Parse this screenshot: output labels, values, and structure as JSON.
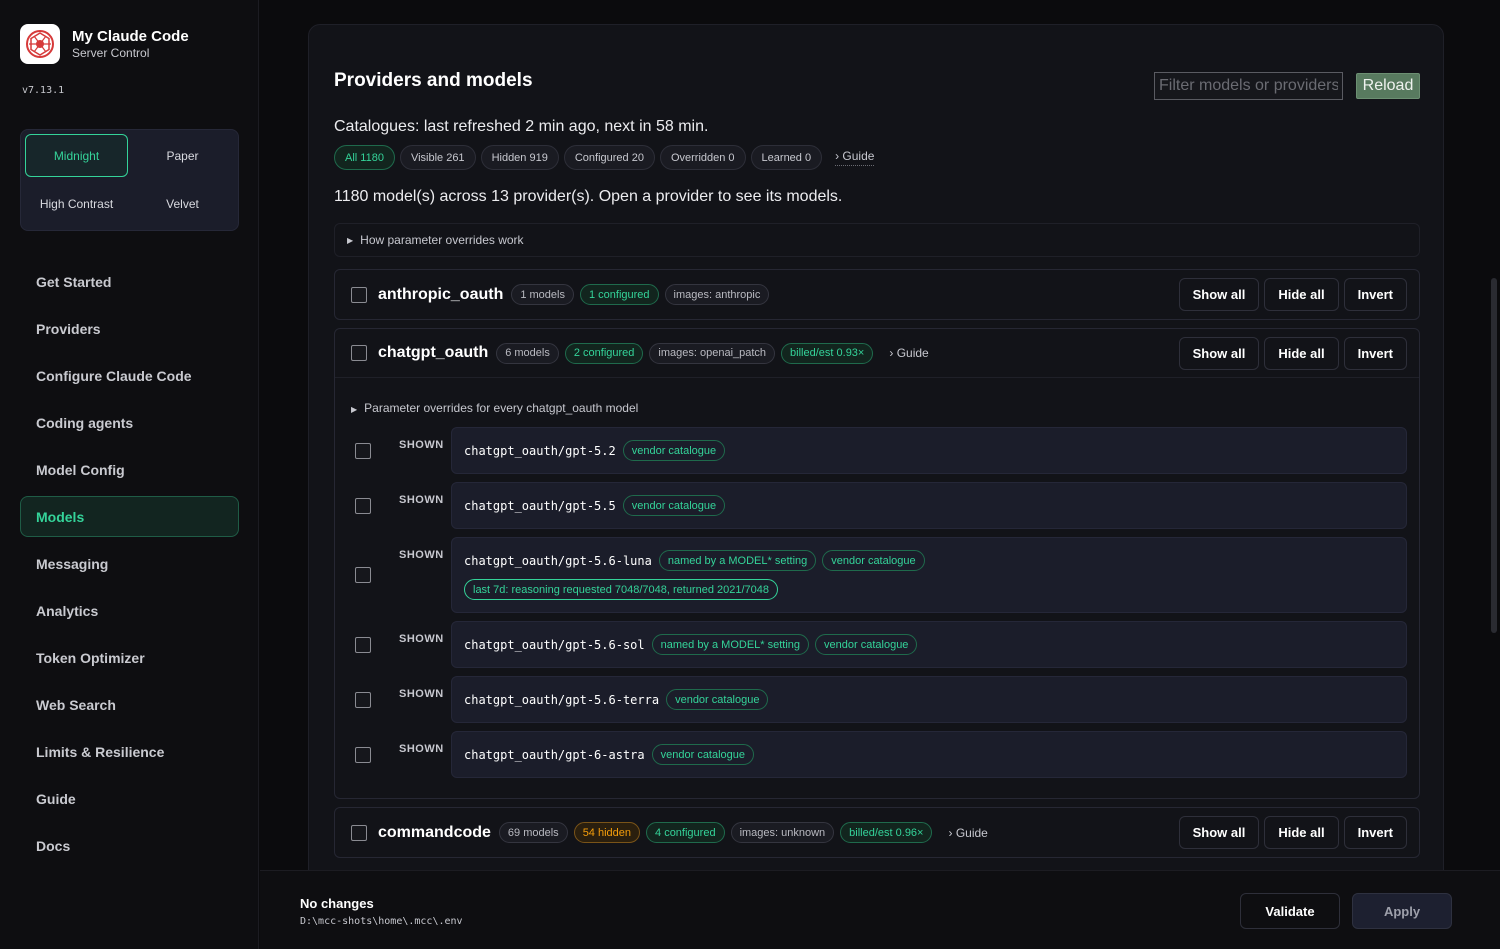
{
  "app": {
    "title": "My Claude Code",
    "subtitle": "Server Control",
    "version": "v7.13.1"
  },
  "themes": [
    "Midnight",
    "Paper",
    "High Contrast",
    "Velvet"
  ],
  "nav": [
    "Get Started",
    "Providers",
    "Configure Claude Code",
    "Coding agents",
    "Model Config",
    "Models",
    "Messaging",
    "Analytics",
    "Token Optimizer",
    "Web Search",
    "Limits & Resilience",
    "Guide",
    "Docs"
  ],
  "main": {
    "title": "Providers and models",
    "filter_placeholder": "Filter models or providers",
    "reload": "Reload",
    "catalogue_status": "Catalogues: last refreshed 2 min ago, next in 58 min.",
    "chips": [
      "All 1180",
      "Visible 261",
      "Hidden 919",
      "Configured 20",
      "Overridden 0",
      "Learned 0"
    ],
    "guide": "› Guide",
    "summary": "1180 model(s) across 13 provider(s). Open a provider to see its models.",
    "howto": "How parameter overrides work",
    "buttons": {
      "show_all": "Show all",
      "hide_all": "Hide all",
      "invert": "Invert"
    }
  },
  "providers": [
    {
      "name": "anthropic_oauth",
      "pills": [
        "1 models",
        "1 configured",
        "images: anthropic"
      ]
    },
    {
      "name": "chatgpt_oauth",
      "pills": [
        "6 models",
        "2 configured",
        "images: openai_patch",
        "billed/est 0.93×"
      ],
      "guide": "› Guide",
      "param_overrides": "Parameter overrides for every chatgpt_oauth model",
      "models": [
        {
          "status": "SHOWN",
          "name": "chatgpt_oauth/gpt-5.2",
          "tags": [
            "vendor catalogue"
          ]
        },
        {
          "status": "SHOWN",
          "name": "chatgpt_oauth/gpt-5.5",
          "tags": [
            "vendor catalogue"
          ]
        },
        {
          "status": "SHOWN",
          "name": "chatgpt_oauth/gpt-5.6-luna",
          "tags": [
            "named by a MODEL* setting",
            "vendor catalogue"
          ],
          "note": "last 7d: reasoning requested 7048/7048, returned 2021/7048"
        },
        {
          "status": "SHOWN",
          "name": "chatgpt_oauth/gpt-5.6-sol",
          "tags": [
            "named by a MODEL* setting",
            "vendor catalogue"
          ]
        },
        {
          "status": "SHOWN",
          "name": "chatgpt_oauth/gpt-5.6-terra",
          "tags": [
            "vendor catalogue"
          ]
        },
        {
          "status": "SHOWN",
          "name": "chatgpt_oauth/gpt-6-astra",
          "tags": [
            "vendor catalogue"
          ]
        }
      ]
    },
    {
      "name": "commandcode",
      "pills": [
        "69 models",
        "54 hidden",
        "4 configured",
        "images: unknown",
        "billed/est 0.96×"
      ],
      "guide": "› Guide"
    }
  ],
  "footer": {
    "status": "No changes",
    "path": "D:\\mcc-shots\\home\\.mcc\\.env",
    "validate": "Validate",
    "apply": "Apply"
  },
  "colors": {
    "accent": "#34d399",
    "warning": "#f59e0b",
    "background": "#0b0b0d",
    "panel": "#121318"
  }
}
